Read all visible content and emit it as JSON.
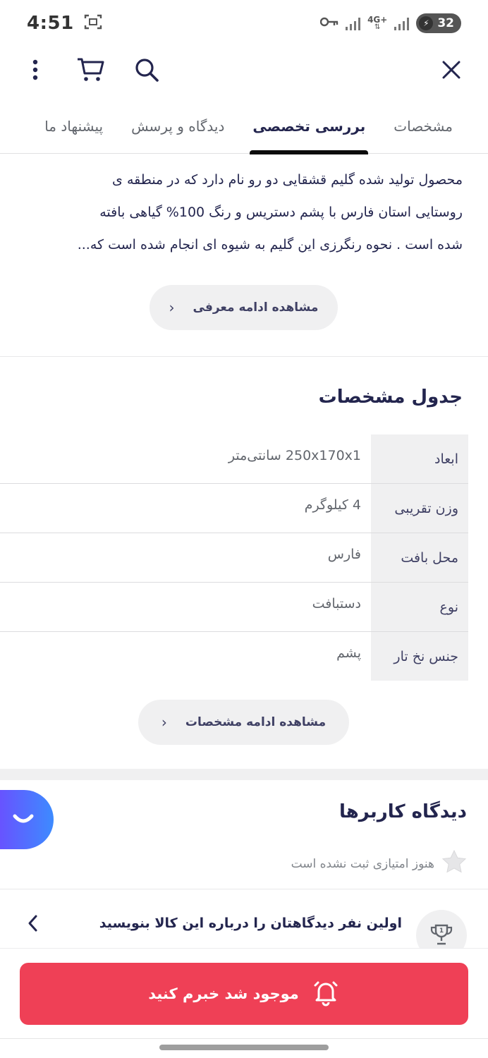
{
  "status_bar": {
    "time": "4:51",
    "network": "4G+",
    "battery": "32"
  },
  "tabs": [
    {
      "label": "مشخصات",
      "active": false
    },
    {
      "label": "بررسی تخصصی",
      "active": true
    },
    {
      "label": "دیدگاه و پرسش",
      "active": false
    },
    {
      "label": "پیشنهاد ما",
      "active": false
    }
  ],
  "intro": {
    "lines": [
      "محصول تولید شده گلیم قشقایی دو رو نام دارد که در منطقه ی",
      "روستایی استان فارس با پشم دستریس و رنگ 100% گیاهی بافته",
      "شده است . نحوه رنگرزی این گلیم به شیوه ای انجام شده است که..."
    ],
    "more_label": "مشاهده ادامه معرفی"
  },
  "specs": {
    "title": "جدول مشخصات",
    "rows": [
      {
        "key": "ابعاد",
        "value": "250x170x1 سانتی‌متر"
      },
      {
        "key": "وزن تقریبی",
        "value": "4 کیلوگرم"
      },
      {
        "key": "محل بافت",
        "value": "فارس"
      },
      {
        "key": "نوع",
        "value": "دستبافت"
      },
      {
        "key": "جنس نخ تار",
        "value": "پشم"
      }
    ],
    "more_label": "مشاهده ادامه مشخصات"
  },
  "reviews": {
    "title": "دیدگاه کاربرها",
    "no_rating": "هنوز امتیازی ثبت نشده است",
    "first_review": "اولین نفر دیدگاهتان را درباره این کالا بنویسید"
  },
  "bottom": {
    "notify_label": "موجود شد خبرم کنید"
  },
  "colors": {
    "accent": "#ef4056",
    "text": "#23254e",
    "fab": "#3d8bff"
  }
}
